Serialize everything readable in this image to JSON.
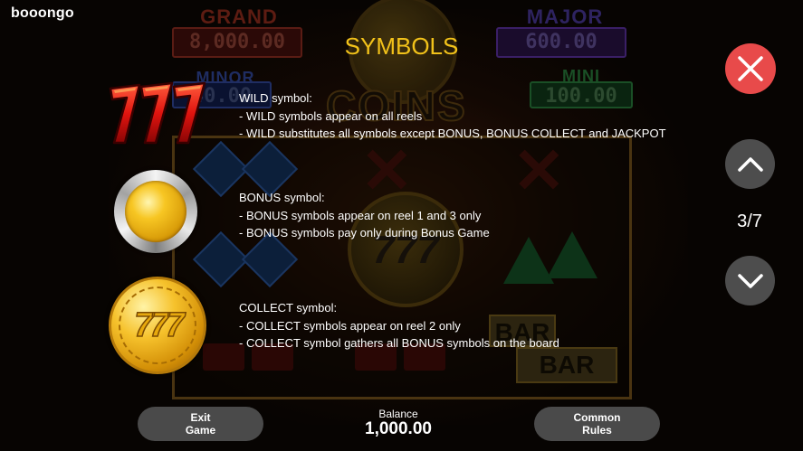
{
  "brand": {
    "logo_text": "booongo"
  },
  "background": {
    "jackpots": {
      "grand_title": "GRAND",
      "grand_value": "8,000.00",
      "major_title": "MAJOR",
      "major_value": "600.00",
      "minor_title": "MINOR",
      "minor_value": "40.00",
      "mini_title": "MINI",
      "mini_value": "100.00"
    },
    "game_logo": "COINS",
    "bar_symbol": "BAR"
  },
  "title": "SYMBOLS",
  "symbols": [
    {
      "icon": "wild-777-icon",
      "heading": "WILD symbol:",
      "lines": [
        "- WILD symbols appear on all reels",
        "- WILD substitutes all symbols except BONUS, BONUS COLLECT and JACKPOT"
      ]
    },
    {
      "icon": "bonus-coin-icon",
      "heading": "BONUS symbol:",
      "lines": [
        "- BONUS symbols appear on reel 1 and 3 only",
        "- BONUS symbols pay only during Bonus Game"
      ]
    },
    {
      "icon": "collect-777-coin-icon",
      "heading": "COLLECT symbol:",
      "lines": [
        "- COLLECT symbols appear on reel 2 only",
        "- COLLECT symbol gathers all BONUS symbols on the board"
      ]
    }
  ],
  "navigation": {
    "close_icon": "close-icon",
    "up_icon": "chevron-up-icon",
    "down_icon": "chevron-down-icon",
    "page_indicator": "3/7"
  },
  "footer": {
    "exit_line1": "Exit",
    "exit_line2": "Game",
    "balance_label": "Balance",
    "balance_value": "1,000.00",
    "rules_line1": "Common",
    "rules_line2": "Rules"
  },
  "colors": {
    "title": "#f2c21a",
    "close_button": "#e84a4a",
    "nav_button": "#4d4d4d",
    "pill_button": "#4a4a4a",
    "background": "#070402"
  }
}
